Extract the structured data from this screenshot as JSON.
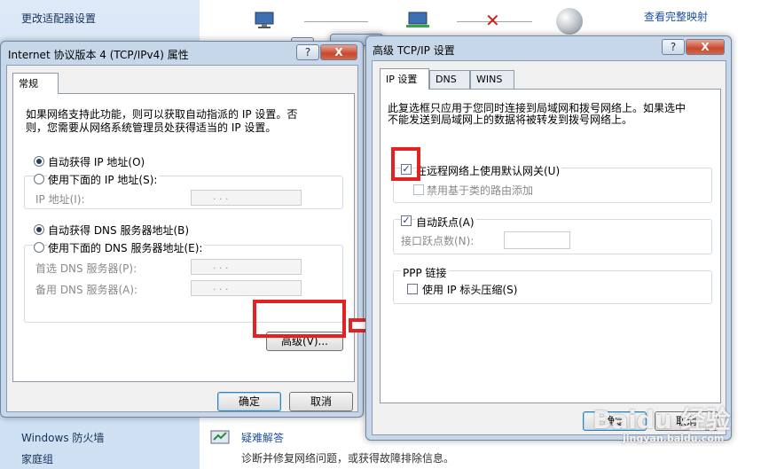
{
  "background": {
    "sidebar_top_link": "更改适配器设置",
    "sidebar_links": [
      "Windows 防火墙",
      "家庭组"
    ],
    "view_full_map": "查看完整映射",
    "troubleshoot_title": "疑难解答",
    "troubleshoot_desc": "诊断并修复网络问题，或获得故障排除信息。"
  },
  "ipv4_dialog": {
    "title": "Internet 协议版本 4 (TCP/IPv4) 属性",
    "help_btn": "?",
    "close_btn": "X",
    "tab_general": "常规",
    "intro": [
      "如果网络支持此功能，则可以获取自动指派的 IP 设置。否",
      "则，您需要从网络系统管理员处获得适当的 IP 设置。"
    ],
    "auto_ip": "自动获得 IP 地址(O)",
    "manual_ip": "使用下面的 IP 地址(S):",
    "ip_address_label": "IP 地址(I):",
    "auto_dns": "自动获得 DNS 服务器地址(B)",
    "manual_dns": "使用下面的 DNS 服务器地址(E):",
    "preferred_dns": "首选 DNS 服务器(P):",
    "alternate_dns": "备用 DNS 服务器(A):",
    "ip_dots": ".     .     .",
    "advanced_btn": "高级(V)...",
    "ok_btn": "确定",
    "cancel_btn": "取消"
  },
  "advanced_dialog": {
    "title": "高级 TCP/IP 设置",
    "help_btn": "?",
    "close_btn": "X",
    "tabs": [
      "IP 设置",
      "DNS",
      "WINS"
    ],
    "intro": [
      "此复选框只应用于您同时连接到局域网和拨号网络上。如果选中",
      "不能发送到局域网上的数据将被转发到拨号网络上。"
    ],
    "use_default_gateway": "在远程网络上使用默认网关(U)",
    "disable_class_routing": "禁用基于类的路由添加",
    "auto_metric": "自动跃点(A)",
    "interface_metric": "接口跃点数(N):",
    "ppp_group": "PPP 链接",
    "ip_header_compression": "使用 IP 标头压缩(S)",
    "ok_btn": "确定",
    "cancel_btn": "取消"
  },
  "watermark": {
    "brand": "Baidu 经验",
    "url": "jingyan.baidu.com"
  },
  "colors": {
    "highlight_red": "#e32222",
    "title_blue": "#c7d7ea"
  }
}
